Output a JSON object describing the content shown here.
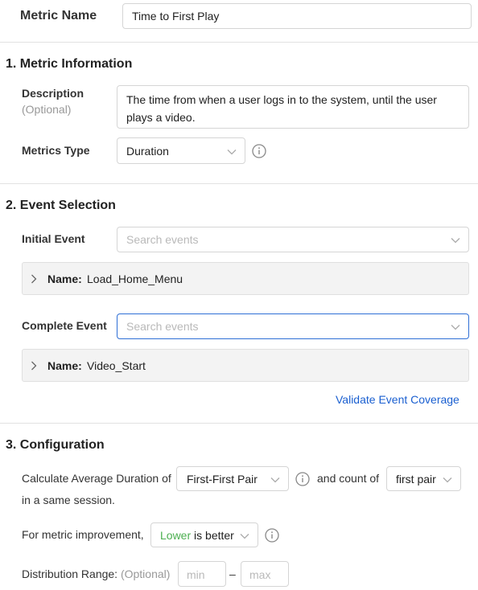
{
  "metric": {
    "name_label": "Metric Name",
    "name_value": "Time to First Play"
  },
  "section1": {
    "title": "1. Metric Information",
    "description_label": "Description",
    "description_optional": "(Optional)",
    "description_value": "The time from when a user logs in to the system, until the user plays a video.",
    "type_label": "Metrics Type",
    "type_value": "Duration"
  },
  "section2": {
    "title": "2. Event Selection",
    "initial_label": "Initial Event",
    "initial_placeholder": "Search events",
    "initial_event_key": "Name:",
    "initial_event_value": "Load_Home_Menu",
    "complete_label": "Complete Event",
    "complete_placeholder": "Search events",
    "complete_event_key": "Name:",
    "complete_event_value": "Video_Start",
    "validate_link": "Validate Event Coverage"
  },
  "section3": {
    "title": "3. Configuration",
    "calc_text": "Calculate Average Duration of",
    "pair_select": "First-First Pair",
    "count_text": "and count of",
    "count_select": "first pair",
    "session_text": "in a same session.",
    "improvement_text": "For metric improvement,",
    "improvement_lower": "Lower",
    "improvement_rest": " is better",
    "distribution_label": "Distribution Range:",
    "distribution_optional": "(Optional)",
    "min_placeholder": "min",
    "max_placeholder": "max",
    "range_sep": "–"
  },
  "colors": {
    "accent_blue": "#1a5fd0",
    "focus_border": "#2f6fd6",
    "green": "#4caf50",
    "muted": "#999999"
  },
  "icons": [
    "chevron-down-icon",
    "info-icon",
    "chevron-right-icon"
  ]
}
